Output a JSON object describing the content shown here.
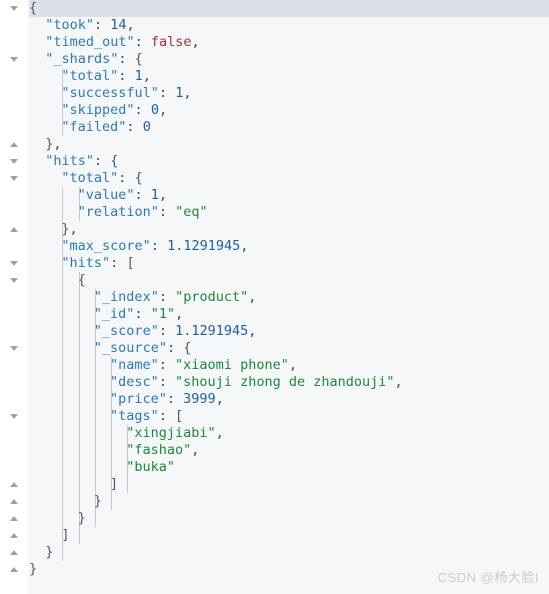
{
  "editor": {
    "title": "JSON response viewer",
    "caret_line_index": 0,
    "line_height": 17,
    "char_width": 8.1,
    "indent_unit": 2,
    "colors": {
      "background": "#f6f7f9",
      "gutter_background": "#ffffff",
      "caret_line": "#dce1e8",
      "key": "#2b7bb9",
      "string": "#1a8a3a",
      "number": "#1f5fa8",
      "keyword": "#a8312a",
      "punctuation": "#3b4a5a",
      "indent_guide": "#c3cad6",
      "fold_arrow": "#9aa0a6",
      "watermark": "#c9ccd2"
    }
  },
  "gutter": {
    "folds": [
      {
        "line": 0,
        "dir": "down",
        "name": "fold-toggle-root-object"
      },
      {
        "line": 3,
        "dir": "down",
        "name": "fold-toggle-shards"
      },
      {
        "line": 8,
        "dir": "up",
        "name": "fold-toggle-shards-end"
      },
      {
        "line": 9,
        "dir": "down",
        "name": "fold-toggle-hits"
      },
      {
        "line": 10,
        "dir": "down",
        "name": "fold-toggle-total"
      },
      {
        "line": 13,
        "dir": "up",
        "name": "fold-toggle-total-end"
      },
      {
        "line": 15,
        "dir": "down",
        "name": "fold-toggle-hits-array"
      },
      {
        "line": 16,
        "dir": "down",
        "name": "fold-toggle-hit-object"
      },
      {
        "line": 20,
        "dir": "down",
        "name": "fold-toggle-source"
      },
      {
        "line": 24,
        "dir": "down",
        "name": "fold-toggle-tags"
      },
      {
        "line": 28,
        "dir": "up",
        "name": "fold-toggle-tags-end"
      },
      {
        "line": 29,
        "dir": "up",
        "name": "fold-toggle-source-end"
      },
      {
        "line": 30,
        "dir": "up",
        "name": "fold-toggle-hit-object-end"
      },
      {
        "line": 31,
        "dir": "up",
        "name": "fold-toggle-hits-array-end"
      },
      {
        "line": 32,
        "dir": "up",
        "name": "fold-toggle-hits-end"
      },
      {
        "line": 33,
        "dir": "up",
        "name": "fold-toggle-root-end"
      }
    ]
  },
  "indent_guides": [
    {
      "indent": 2,
      "from_line": 4,
      "to_line": 7
    },
    {
      "indent": 2,
      "from_line": 11,
      "to_line": 32
    },
    {
      "indent": 3,
      "from_line": 11,
      "to_line": 12
    },
    {
      "indent": 3,
      "from_line": 16,
      "to_line": 31
    },
    {
      "indent": 4,
      "from_line": 17,
      "to_line": 30
    },
    {
      "indent": 5,
      "from_line": 21,
      "to_line": 29
    },
    {
      "indent": 6,
      "from_line": 25,
      "to_line": 28
    }
  ],
  "json_document": {
    "took": 14,
    "timed_out": false,
    "_shards": {
      "total": 1,
      "successful": 1,
      "skipped": 0,
      "failed": 0
    },
    "hits": {
      "total": {
        "value": 1,
        "relation": "eq"
      },
      "max_score": 1.1291945,
      "hits": [
        {
          "_index": "product",
          "_id": "1",
          "_score": 1.1291945,
          "_source": {
            "name": "xiaomi phone",
            "desc": "shouji zhong de zhandouji",
            "price": 3999,
            "tags": [
              "xingjiabi",
              "fashao",
              "buka"
            ]
          }
        }
      ]
    }
  },
  "lines": [
    {
      "indent": 0,
      "tokens": [
        {
          "t": "{",
          "c": "br"
        }
      ]
    },
    {
      "indent": 1,
      "tokens": [
        {
          "t": "\"took\"",
          "c": "k"
        },
        {
          "t": ": ",
          "c": "p"
        },
        {
          "t": "14",
          "c": "n"
        },
        {
          "t": ",",
          "c": "p"
        }
      ]
    },
    {
      "indent": 1,
      "tokens": [
        {
          "t": "\"timed_out\"",
          "c": "k"
        },
        {
          "t": ": ",
          "c": "p"
        },
        {
          "t": "false",
          "c": "kw"
        },
        {
          "t": ",",
          "c": "p"
        }
      ]
    },
    {
      "indent": 1,
      "tokens": [
        {
          "t": "\"_shards\"",
          "c": "k"
        },
        {
          "t": ": ",
          "c": "p"
        },
        {
          "t": "{",
          "c": "br"
        }
      ]
    },
    {
      "indent": 2,
      "tokens": [
        {
          "t": "\"total\"",
          "c": "k"
        },
        {
          "t": ": ",
          "c": "p"
        },
        {
          "t": "1",
          "c": "n"
        },
        {
          "t": ",",
          "c": "p"
        }
      ]
    },
    {
      "indent": 2,
      "tokens": [
        {
          "t": "\"successful\"",
          "c": "k"
        },
        {
          "t": ": ",
          "c": "p"
        },
        {
          "t": "1",
          "c": "n"
        },
        {
          "t": ",",
          "c": "p"
        }
      ]
    },
    {
      "indent": 2,
      "tokens": [
        {
          "t": "\"skipped\"",
          "c": "k"
        },
        {
          "t": ": ",
          "c": "p"
        },
        {
          "t": "0",
          "c": "n"
        },
        {
          "t": ",",
          "c": "p"
        }
      ]
    },
    {
      "indent": 2,
      "tokens": [
        {
          "t": "\"failed\"",
          "c": "k"
        },
        {
          "t": ": ",
          "c": "p"
        },
        {
          "t": "0",
          "c": "n"
        }
      ]
    },
    {
      "indent": 1,
      "tokens": [
        {
          "t": "}",
          "c": "br"
        },
        {
          "t": ",",
          "c": "p"
        }
      ]
    },
    {
      "indent": 1,
      "tokens": [
        {
          "t": "\"hits\"",
          "c": "k"
        },
        {
          "t": ": ",
          "c": "p"
        },
        {
          "t": "{",
          "c": "br"
        }
      ]
    },
    {
      "indent": 2,
      "tokens": [
        {
          "t": "\"total\"",
          "c": "k"
        },
        {
          "t": ": ",
          "c": "p"
        },
        {
          "t": "{",
          "c": "br"
        }
      ]
    },
    {
      "indent": 3,
      "tokens": [
        {
          "t": "\"value\"",
          "c": "k"
        },
        {
          "t": ": ",
          "c": "p"
        },
        {
          "t": "1",
          "c": "n"
        },
        {
          "t": ",",
          "c": "p"
        }
      ]
    },
    {
      "indent": 3,
      "tokens": [
        {
          "t": "\"relation\"",
          "c": "k"
        },
        {
          "t": ": ",
          "c": "p"
        },
        {
          "t": "\"eq\"",
          "c": "s"
        }
      ]
    },
    {
      "indent": 2,
      "tokens": [
        {
          "t": "}",
          "c": "br"
        },
        {
          "t": ",",
          "c": "p"
        }
      ]
    },
    {
      "indent": 2,
      "tokens": [
        {
          "t": "\"max_score\"",
          "c": "k"
        },
        {
          "t": ": ",
          "c": "p"
        },
        {
          "t": "1.1291945",
          "c": "n"
        },
        {
          "t": ",",
          "c": "p"
        }
      ]
    },
    {
      "indent": 2,
      "tokens": [
        {
          "t": "\"hits\"",
          "c": "k"
        },
        {
          "t": ": ",
          "c": "p"
        },
        {
          "t": "[",
          "c": "br"
        }
      ]
    },
    {
      "indent": 3,
      "tokens": [
        {
          "t": "{",
          "c": "br"
        }
      ]
    },
    {
      "indent": 4,
      "tokens": [
        {
          "t": "\"_index\"",
          "c": "k"
        },
        {
          "t": ": ",
          "c": "p"
        },
        {
          "t": "\"product\"",
          "c": "s"
        },
        {
          "t": ",",
          "c": "p"
        }
      ]
    },
    {
      "indent": 4,
      "tokens": [
        {
          "t": "\"_id\"",
          "c": "k"
        },
        {
          "t": ": ",
          "c": "p"
        },
        {
          "t": "\"1\"",
          "c": "s"
        },
        {
          "t": ",",
          "c": "p"
        }
      ]
    },
    {
      "indent": 4,
      "tokens": [
        {
          "t": "\"_score\"",
          "c": "k"
        },
        {
          "t": ": ",
          "c": "p"
        },
        {
          "t": "1.1291945",
          "c": "n"
        },
        {
          "t": ",",
          "c": "p"
        }
      ]
    },
    {
      "indent": 4,
      "tokens": [
        {
          "t": "\"_source\"",
          "c": "k"
        },
        {
          "t": ": ",
          "c": "p"
        },
        {
          "t": "{",
          "c": "br"
        }
      ]
    },
    {
      "indent": 5,
      "tokens": [
        {
          "t": "\"name\"",
          "c": "k"
        },
        {
          "t": ": ",
          "c": "p"
        },
        {
          "t": "\"xiaomi phone\"",
          "c": "s"
        },
        {
          "t": ",",
          "c": "p"
        }
      ]
    },
    {
      "indent": 5,
      "tokens": [
        {
          "t": "\"desc\"",
          "c": "k"
        },
        {
          "t": ": ",
          "c": "p"
        },
        {
          "t": "\"shouji zhong de zhandouji\"",
          "c": "s"
        },
        {
          "t": ",",
          "c": "p"
        }
      ]
    },
    {
      "indent": 5,
      "tokens": [
        {
          "t": "\"price\"",
          "c": "k"
        },
        {
          "t": ": ",
          "c": "p"
        },
        {
          "t": "3999",
          "c": "n"
        },
        {
          "t": ",",
          "c": "p"
        }
      ]
    },
    {
      "indent": 5,
      "tokens": [
        {
          "t": "\"tags\"",
          "c": "k"
        },
        {
          "t": ": ",
          "c": "p"
        },
        {
          "t": "[",
          "c": "br"
        }
      ]
    },
    {
      "indent": 6,
      "tokens": [
        {
          "t": "\"xingjiabi\"",
          "c": "s"
        },
        {
          "t": ",",
          "c": "p"
        }
      ]
    },
    {
      "indent": 6,
      "tokens": [
        {
          "t": "\"fashao\"",
          "c": "s"
        },
        {
          "t": ",",
          "c": "p"
        }
      ]
    },
    {
      "indent": 6,
      "tokens": [
        {
          "t": "\"buka\"",
          "c": "s"
        }
      ]
    },
    {
      "indent": 5,
      "tokens": [
        {
          "t": "]",
          "c": "br"
        }
      ]
    },
    {
      "indent": 4,
      "tokens": [
        {
          "t": "}",
          "c": "br"
        }
      ]
    },
    {
      "indent": 3,
      "tokens": [
        {
          "t": "}",
          "c": "br"
        }
      ]
    },
    {
      "indent": 2,
      "tokens": [
        {
          "t": "]",
          "c": "br"
        }
      ]
    },
    {
      "indent": 1,
      "tokens": [
        {
          "t": "}",
          "c": "br"
        }
      ]
    },
    {
      "indent": 0,
      "tokens": [
        {
          "t": "}",
          "c": "br"
        }
      ]
    }
  ],
  "watermark": {
    "text": "CSDN @杨大脸I"
  }
}
